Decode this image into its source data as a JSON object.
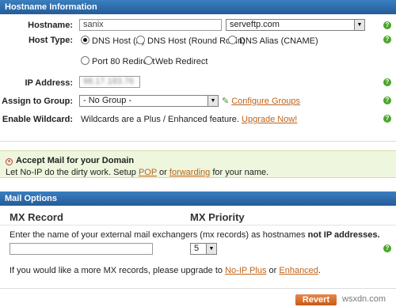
{
  "hostname_section": {
    "title": "Hostname Information",
    "hostname_label": "Hostname:",
    "hostname_value": "sanix",
    "domain_value": "serveftp.com",
    "host_type_label": "Host Type:",
    "host_types": [
      "DNS Host (A)",
      "DNS Host (Round Robin)",
      "DNS Alias (CNAME)",
      "Port 80 Redirect",
      "Web Redirect"
    ],
    "selected_host_type": "DNS Host (A)",
    "ip_label": "IP Address:",
    "ip_value": "98.17.183.76",
    "group_label": "Assign to Group:",
    "group_value": "- No Group -",
    "configure_groups": "Configure Groups",
    "wildcard_label": "Enable Wildcard:",
    "wildcard_text": "Wildcards are a Plus / Enhanced feature.",
    "upgrade_link": "Upgrade Now!"
  },
  "accept_mail": {
    "title": "Accept Mail for your Domain",
    "text_prefix": "Let No-IP do the dirty work. Setup",
    "pop": "POP",
    "or": "or",
    "forwarding": "forwarding",
    "text_suffix": "for your name."
  },
  "mail_options": {
    "title": "Mail Options",
    "mx_record_header": "MX Record",
    "mx_priority_header": "MX Priority",
    "instruction": "Enter the name of your external mail exchangers (mx records) as hostnames",
    "instruction_bold": "not IP addresses.",
    "mx_value": "",
    "priority_value": "5",
    "more_prefix": "If you would like a more MX records, please upgrade to",
    "noip_plus": "No-IP Plus",
    "or": "or",
    "enhanced": "Enhanced",
    "more_suffix": "."
  },
  "footer": {
    "revert": "Revert",
    "watermark": "wsxdn.com"
  },
  "colors": {
    "header_blue": "#2f6eab",
    "link_orange": "#c0631a",
    "help_green": "#4aa52a",
    "accept_bg": "#eef6de"
  }
}
